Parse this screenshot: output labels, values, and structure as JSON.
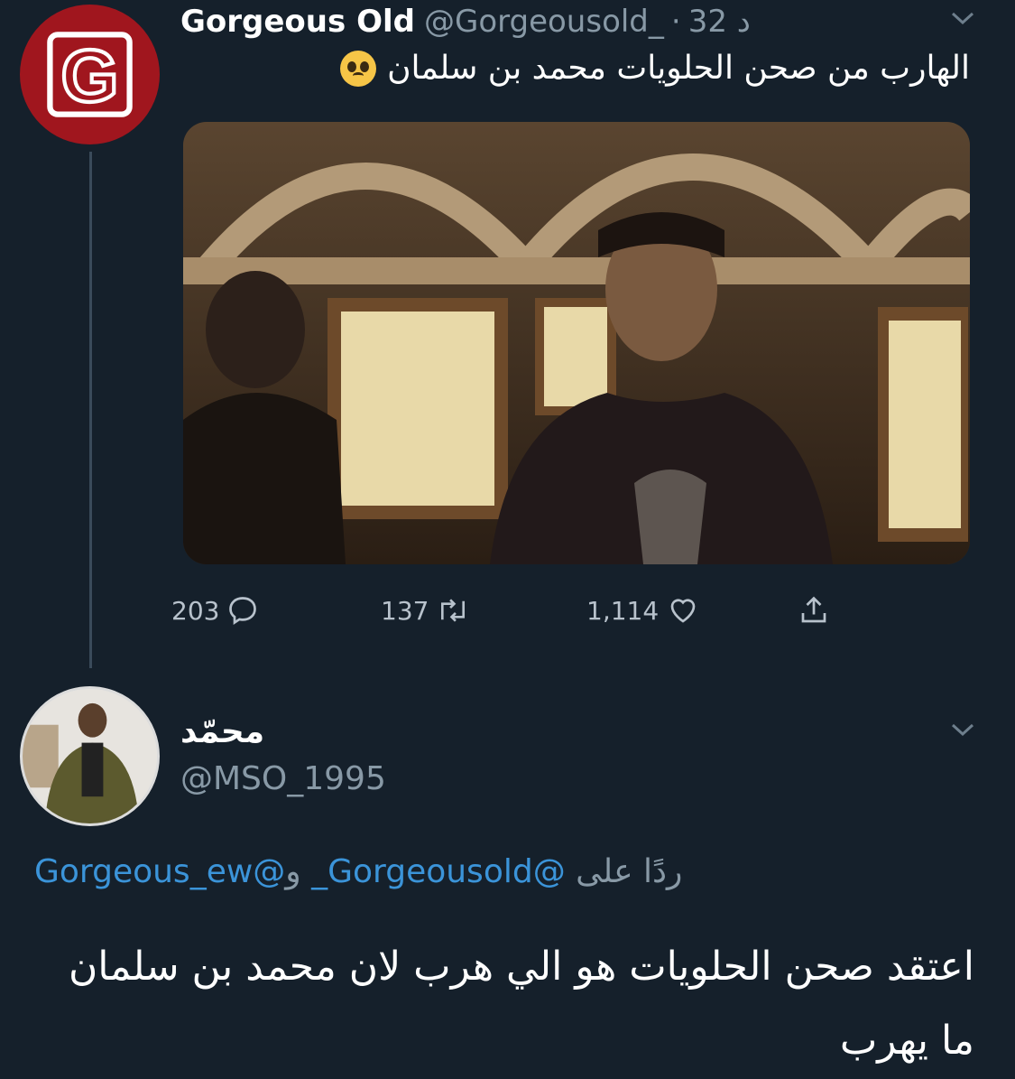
{
  "parent_tweet": {
    "avatar_letter": "G",
    "display_name": "Gorgeous Old",
    "handle": "@Gorgeousold_",
    "separator": "·",
    "time": "32 د",
    "text": "الهارب من صحن الحلويات محمد بن سلمان",
    "emoji_icon": "pleading-face-icon",
    "actions": {
      "replies": "203",
      "retweets": "137",
      "likes": "1,114"
    }
  },
  "reply_tweet": {
    "display_name": "محمّد",
    "handle": "@MSO_1995",
    "reply_label": "ردًا على",
    "mention_1": "@Gorgeousold_",
    "conjunction": "و",
    "mention_2": "@Gorgeous_ew",
    "text": "اعتقد صحن الحلويات هو الي هرب لان محمد بن سلمان ما يهرب"
  },
  "colors": {
    "background": "#15202b",
    "avatar_red": "#a0161e",
    "link_blue": "#3b94d9",
    "muted": "#8899a6"
  }
}
